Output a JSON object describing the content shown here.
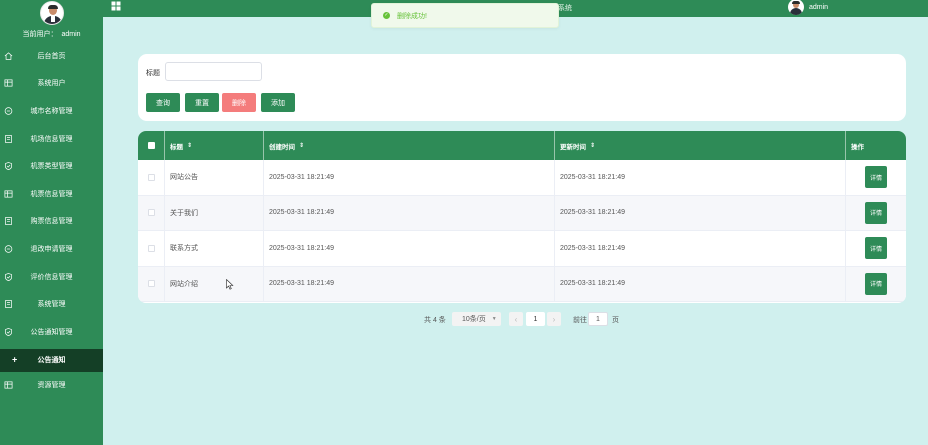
{
  "sidebar": {
    "current_user_label": "当前用户：",
    "current_user_name": "admin",
    "items": [
      {
        "label": "后台首页",
        "icon": "home-icon"
      },
      {
        "label": "系统用户",
        "icon": "table-icon"
      },
      {
        "label": "城市名称管理",
        "icon": "chat-icon"
      },
      {
        "label": "机场信息管理",
        "icon": "document-icon"
      },
      {
        "label": "机票类型管理",
        "icon": "shield-icon"
      },
      {
        "label": "机票信息管理",
        "icon": "table-icon"
      },
      {
        "label": "购票信息管理",
        "icon": "document-icon"
      },
      {
        "label": "退改申请管理",
        "icon": "chat-icon"
      },
      {
        "label": "评价信息管理",
        "icon": "shield-icon"
      },
      {
        "label": "系统管理",
        "icon": "document-icon"
      },
      {
        "label": "公告通知管理",
        "icon": "shield-icon"
      },
      {
        "label": "公告通知",
        "icon": "plus-icon",
        "active": true
      },
      {
        "label": "资源管理",
        "icon": "table-icon"
      }
    ]
  },
  "topbar": {
    "title": "系统",
    "user": "admin"
  },
  "toast": {
    "message": "删除成功!"
  },
  "search": {
    "label": "标题",
    "value": "",
    "placeholder": "",
    "buttons": {
      "query": "查询",
      "reset": "重置",
      "delete": "删除",
      "add": "添加"
    }
  },
  "table": {
    "columns": [
      "标题",
      "创建时间",
      "更新时间",
      "操作"
    ],
    "rows": [
      {
        "title": "网站公告",
        "created": "2025-03-31 18:21:49",
        "updated": "2025-03-31 18:21:49",
        "action": "详情"
      },
      {
        "title": "关于我们",
        "created": "2025-03-31 18:21:49",
        "updated": "2025-03-31 18:21:49",
        "action": "详情"
      },
      {
        "title": "联系方式",
        "created": "2025-03-31 18:21:49",
        "updated": "2025-03-31 18:21:49",
        "action": "详情"
      },
      {
        "title": "网站介绍",
        "created": "2025-03-31 18:21:49",
        "updated": "2025-03-31 18:21:49",
        "action": "详情"
      }
    ]
  },
  "pagination": {
    "total": "共 4 条",
    "page_size": "10条/页",
    "current_page": "1",
    "goto_label": "前往",
    "goto_value": "1",
    "page_unit": "页"
  },
  "colors": {
    "primary": "#2e8b57",
    "background": "#d0f0ee",
    "danger": "#f47c7c",
    "active_menu": "#143f26",
    "success_text": "#67c23a"
  }
}
